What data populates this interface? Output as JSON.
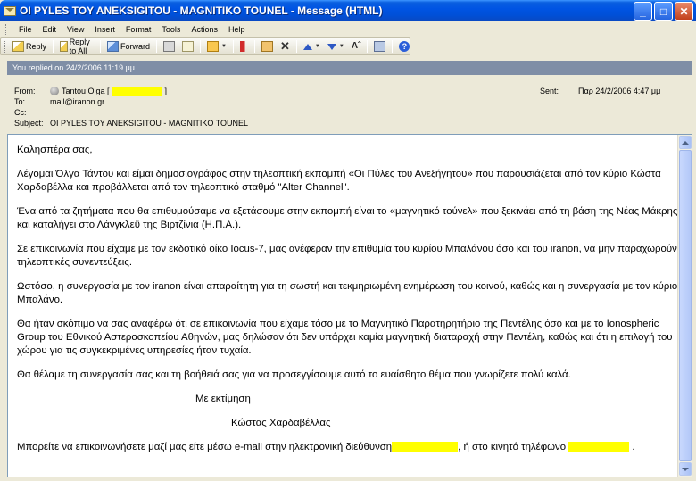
{
  "window": {
    "title": "OI PYLES TOY ANEKSIGITOU - MAGNITIKO TOUNEL - Message (HTML)",
    "minimize": "_",
    "maximize": "□",
    "close": "✕"
  },
  "menu": [
    "File",
    "Edit",
    "View",
    "Insert",
    "Format",
    "Tools",
    "Actions",
    "Help"
  ],
  "toolbar": {
    "reply": "Reply",
    "reply_all": "Reply to All",
    "forward": "Forward"
  },
  "infobar": "You replied on 24/2/2006 11:19 μμ.",
  "headers": {
    "from_label": "From:",
    "from_value": "Tantou Olga [",
    "from_close": "]",
    "to_label": "To:",
    "to_value": "mail@iranon.gr",
    "cc_label": "Cc:",
    "cc_value": "",
    "subject_label": "Subject:",
    "subject_value": "OI PYLES TOY ANEKSIGITOU - MAGNITIKO TOUNEL",
    "sent_label": "Sent:",
    "sent_value": "Παρ 24/2/2006 4:47 μμ"
  },
  "body": {
    "greeting": "Καλησπέρα σας,",
    "p1": "Λέγομαι Όλγα Τάντου και είμαι δημοσιογράφος στην τηλεοπτική εκπομπή «Οι Πύλες του Ανεξήγητου» που παρουσιάζεται από τον κύριο Κώστα Χαρδαβέλλα και προβάλλεται από τον τηλεοπτικό σταθμό \"Alter Channel\".",
    "p2": "Ένα από τα ζητήματα που θα επιθυμούσαμε να εξετάσουμε στην εκπομπή είναι το «μαγνητικό τούνελ» που ξεκινάει από τη βάση της Νέας Μάκρης και καταλήγει στο Λάνγκλεϋ της Βιρτζίνια (Η.Π.Α.).",
    "p3": "Σε επικοινωνία που είχαμε με τον εκδοτικό οίκο Iocus-7, μας ανέφεραν την επιθυμία του κυρίου Μπαλάνου όσο και του iranon, να μην παραχωρούν τηλεοπτικές συνεντεύξεις.",
    "p4": "Ωστόσο, η  συνεργασία με τον iranon είναι απαραίτητη για τη σωστή και τεκμηριωμένη ενημέρωση του κοινού, καθώς και η συνεργασία με τον κύριο Μπαλάνο.",
    "p5": "Θα ήταν σκόπιμο να σας αναφέρω ότι σε επικοινωνία που είχαμε τόσο με το Μαγνητικό Παρατηρητήριο της Πεντέλης όσο και με το Ionospheric Group του Εθνικού Αστεροσκοπείου Αθηνών, μας δηλώσαν ότι δεν υπάρχει καμία μαγνητική διαταραχή στην Πεντέλη, καθώς και ότι η επιλογή του χώρου για τις συγκεκριμένες υπηρεσίες ήταν τυχαία.",
    "p6": "Θα θέλαμε τη συνεργασία σας και τη βοήθειά σας για να προσεγγίσουμε αυτό το ευαίσθητο θέμα που γνωρίζετε πολύ καλά.",
    "closing": "Με εκτίμηση",
    "signature": "Κώστας Χαρδαβέλλας",
    "contact_start": "Μπορείτε να επικοινωνήσετε μαζί μας είτε μέσω e-mail στην ηλεκτρονική διεύθυνση",
    "contact_mid": ", ή στο κινητό τηλέφωνο",
    "contact_end": "."
  },
  "colors": {
    "titlebar": "#0054e3",
    "infobar": "#7f8ea6",
    "redaction": "#ffff00"
  }
}
